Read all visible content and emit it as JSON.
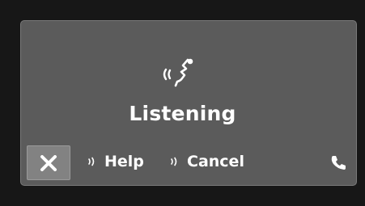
{
  "dialog": {
    "status_label": "Listening",
    "status_icon": "voice-listening-icon",
    "close_icon": "close-x-icon"
  },
  "commands": [
    {
      "icon": "voice-wave-icon",
      "label": "Help"
    },
    {
      "icon": "voice-wave-icon",
      "label": "Cancel"
    }
  ],
  "phone": {
    "icon": "phone-icon"
  },
  "colors": {
    "background": "#171717",
    "panel": "#5b5b5b",
    "panel_border": "#7a7a7a",
    "close_button": "#828282",
    "text": "#ffffff"
  }
}
